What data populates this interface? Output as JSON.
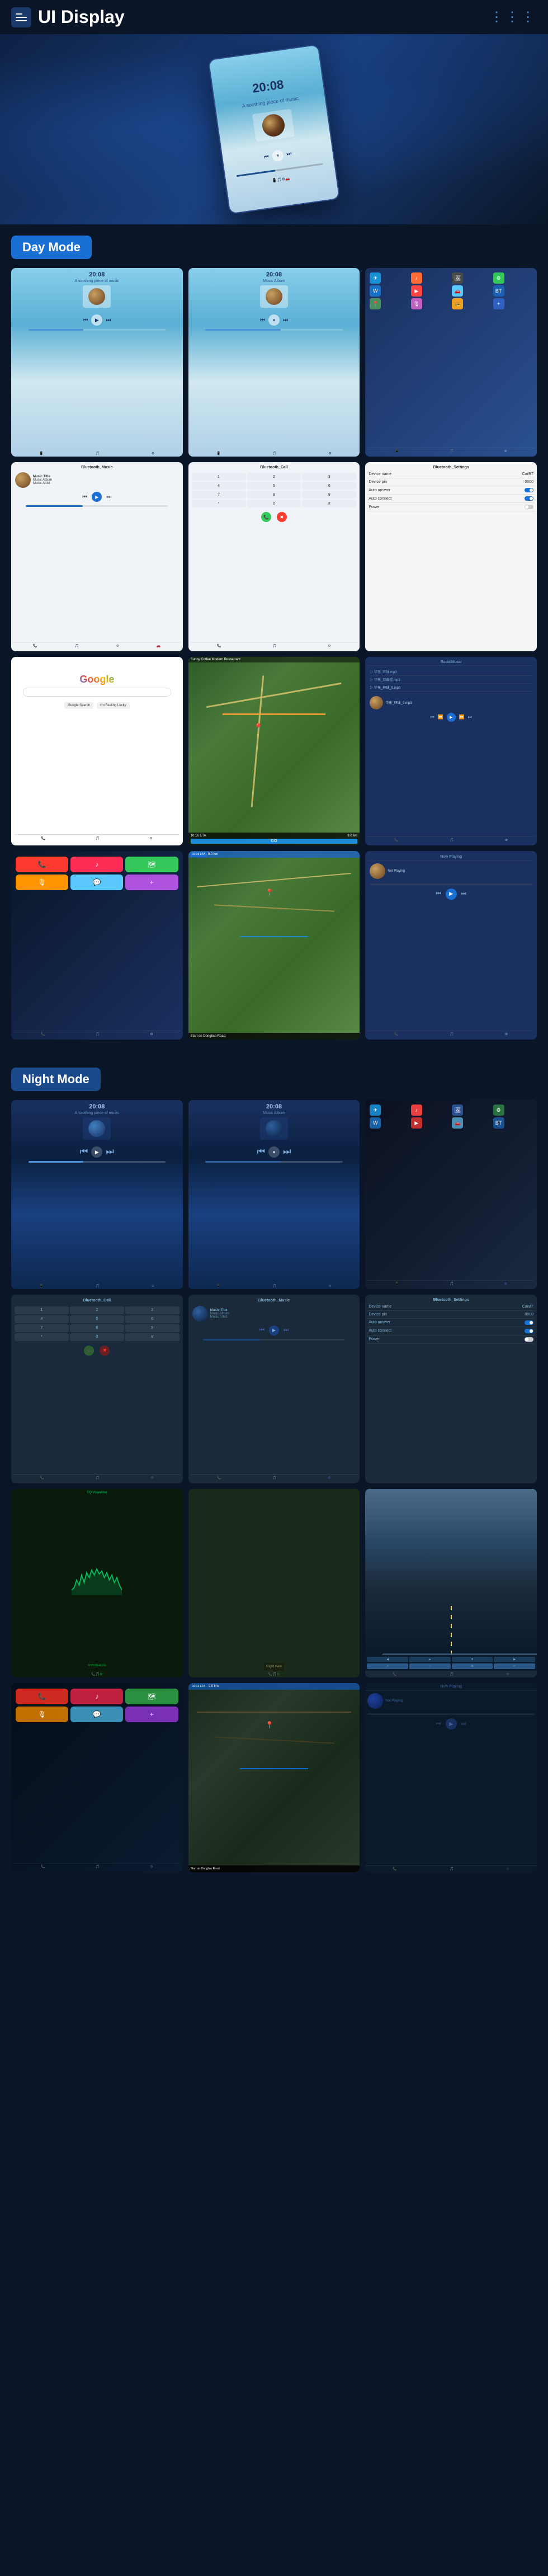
{
  "header": {
    "title": "UI Display",
    "menu_icon": "☰",
    "nav_icon": "≡"
  },
  "modes": {
    "day": "Day Mode",
    "night": "Night Mode"
  },
  "screens": {
    "time": "20:08",
    "music": {
      "title": "Music Title",
      "album": "Music Album",
      "artist": "Music Artist"
    },
    "bluetooth": {
      "music": "Bluetooth_Music",
      "call": "Bluetooth_Call",
      "settings": "Bluetooth_Settings"
    },
    "settings": {
      "device_name_label": "Device name",
      "device_name_value": "CarBT",
      "device_pin_label": "Device pin",
      "device_pin_value": "0000",
      "auto_answer_label": "Auto answer",
      "auto_connect_label": "Auto connect",
      "power_label": "Power"
    },
    "navigation": {
      "restaurant": "Sunny Coffee Modern Restaurant",
      "eta_label": "10:16 ETA",
      "distance": "9.0 km",
      "go_button": "GO",
      "start_label": "Start on Dongliao Road",
      "not_playing": "Not Playing"
    },
    "music_list": {
      "items": [
        "华东_环球.mp3",
        "华东_双截棍.mp3",
        "华东_环球_9.mp3"
      ]
    }
  },
  "colors": {
    "primary_blue": "#1a6fd4",
    "dark_bg": "#0a1628",
    "card_bg": "#0d1f3c",
    "accent": "#4a90d9",
    "green": "#00c060",
    "night_blue": "#1a4a8a"
  }
}
